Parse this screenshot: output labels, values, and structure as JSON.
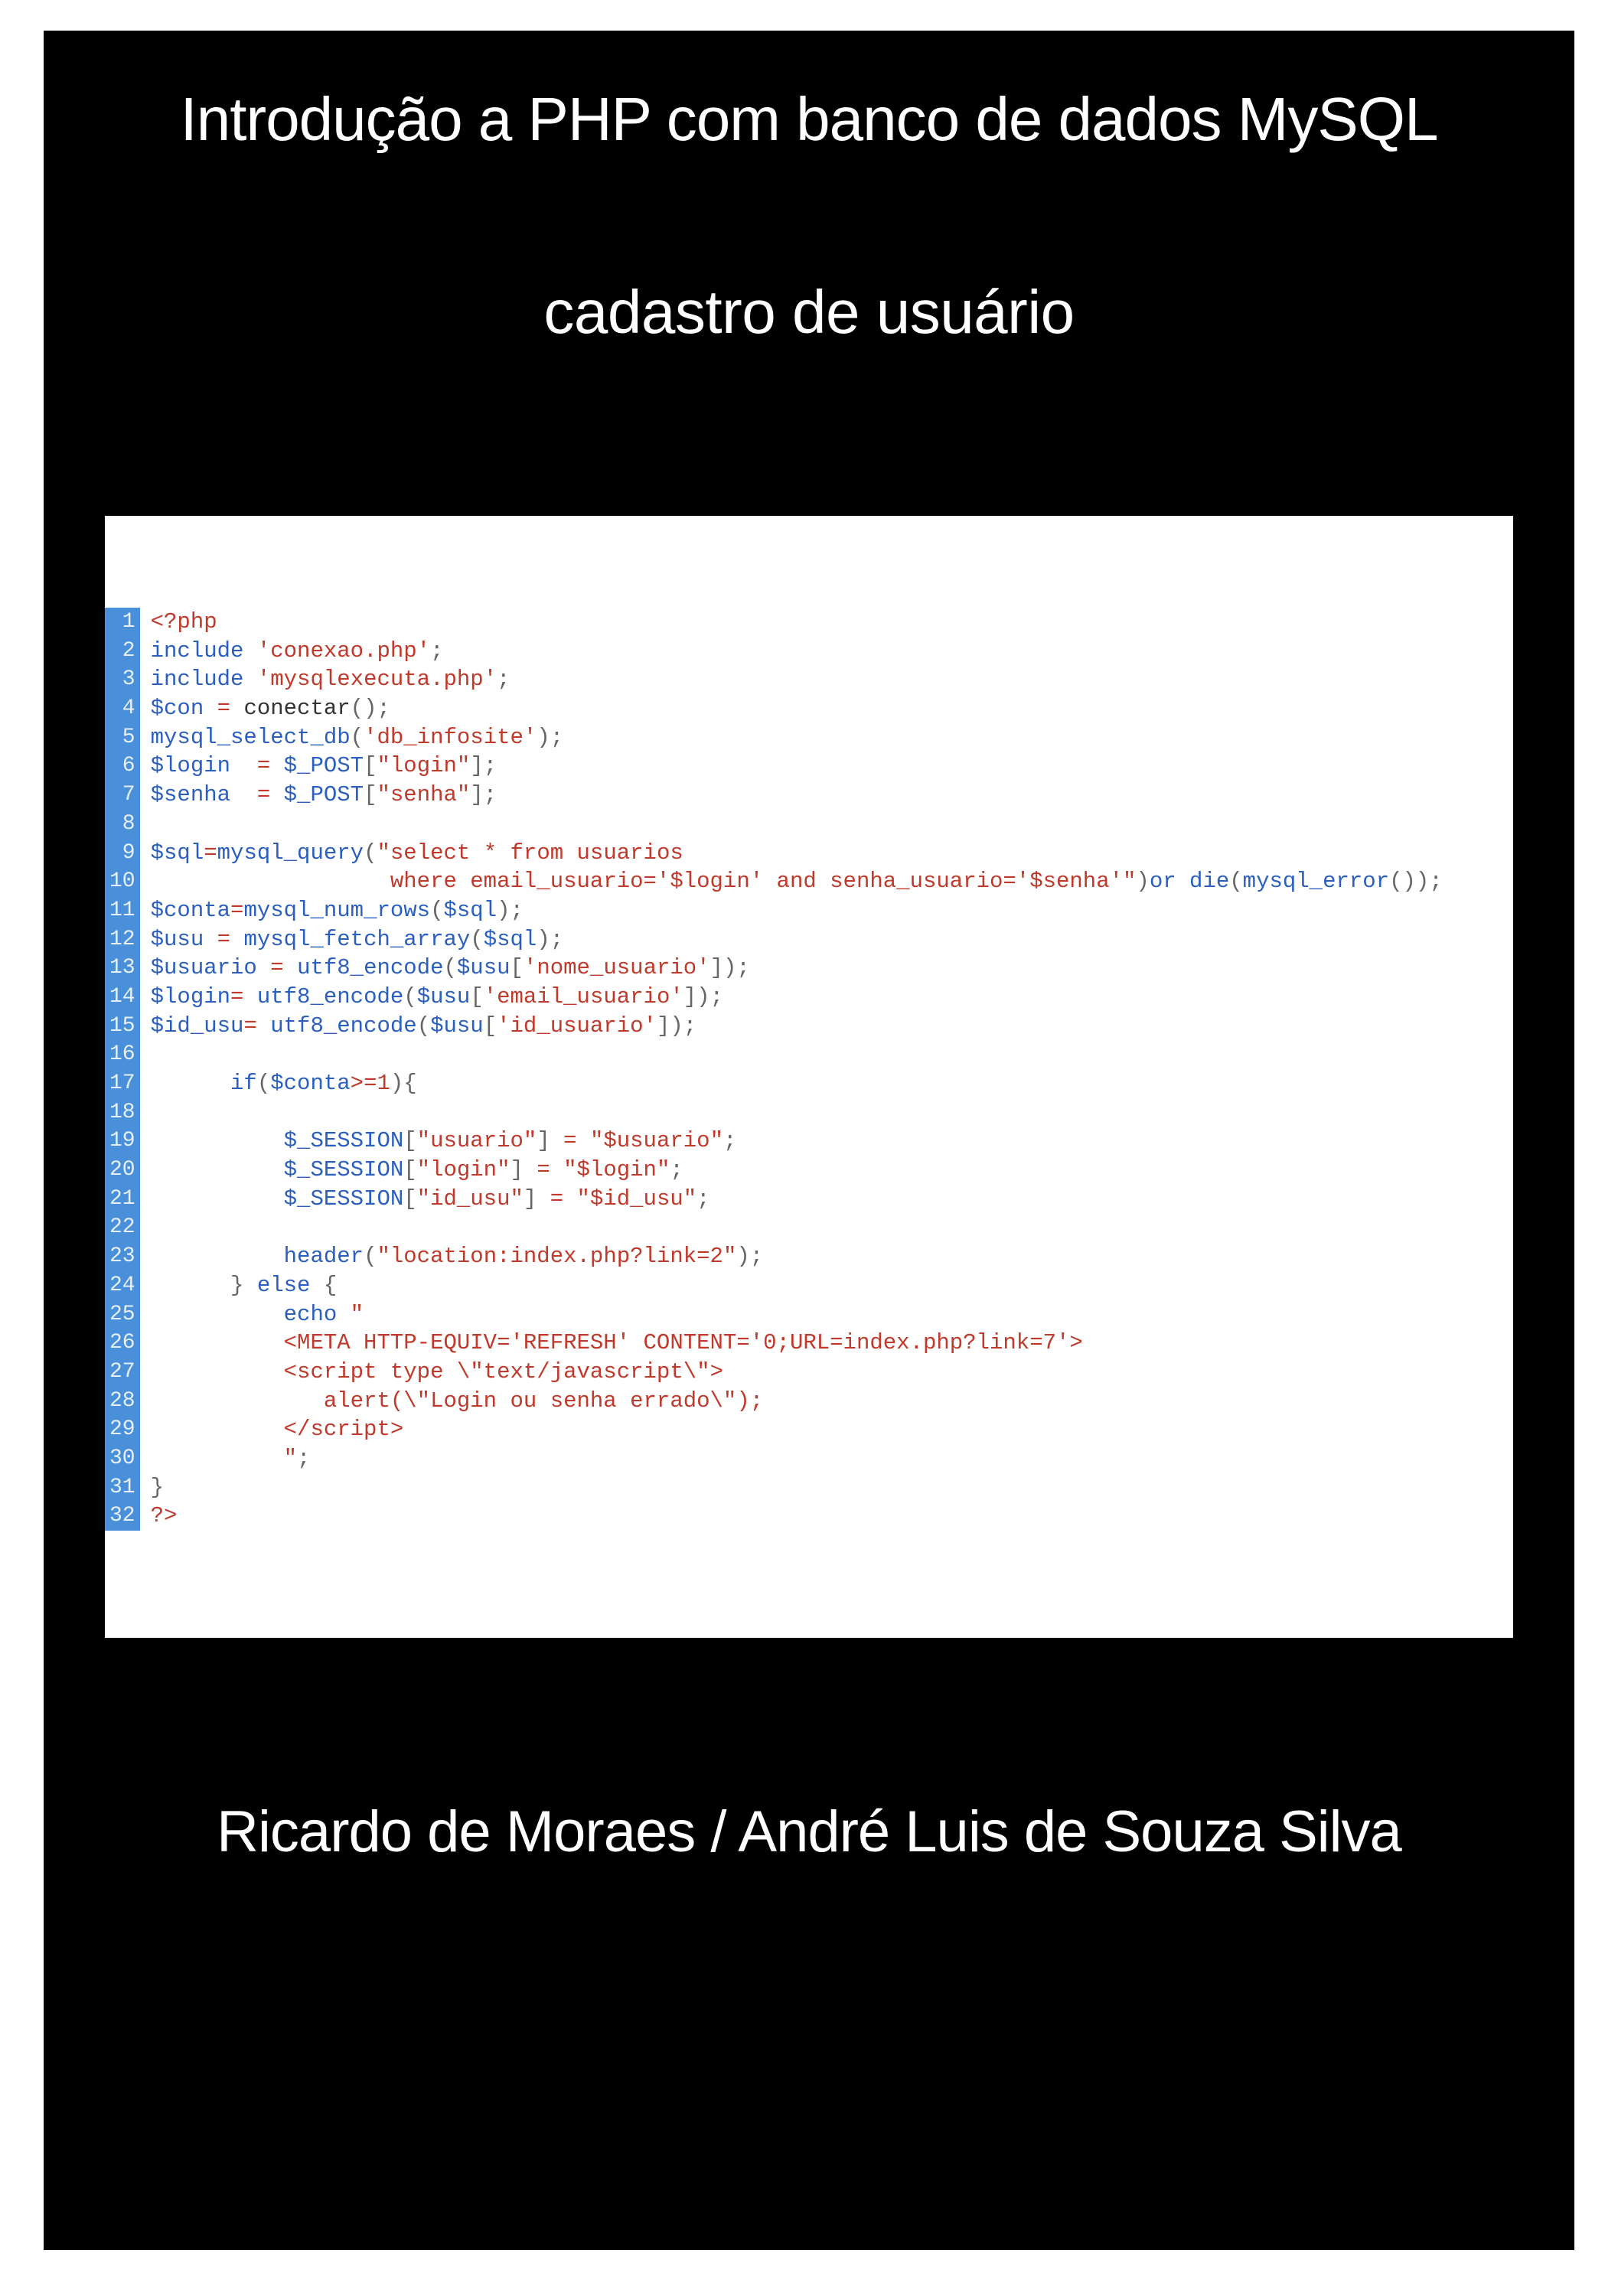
{
  "title": "Introdução a PHP com banco de dados MySQL",
  "subtitle": "cadastro de usuário",
  "authors": "Ricardo de Moraes / André Luis de Souza Silva",
  "code": {
    "lines": [
      {
        "n": 1,
        "segs": [
          {
            "t": "<?php",
            "c": "c-red"
          }
        ]
      },
      {
        "n": 2,
        "segs": [
          {
            "t": "include ",
            "c": "c-blue"
          },
          {
            "t": "'conexao.php'",
            "c": "c-red"
          },
          {
            "t": ";",
            "c": "c-gray"
          }
        ]
      },
      {
        "n": 3,
        "segs": [
          {
            "t": "include ",
            "c": "c-blue"
          },
          {
            "t": "'mysqlexecuta.php'",
            "c": "c-red"
          },
          {
            "t": ";",
            "c": "c-gray"
          }
        ]
      },
      {
        "n": 4,
        "segs": [
          {
            "t": "$con ",
            "c": "c-blue"
          },
          {
            "t": "= ",
            "c": "c-red"
          },
          {
            "t": "conectar",
            "c": "c-dark"
          },
          {
            "t": "();",
            "c": "c-gray"
          }
        ]
      },
      {
        "n": 5,
        "segs": [
          {
            "t": "mysql_select_db",
            "c": "c-blue"
          },
          {
            "t": "(",
            "c": "c-gray"
          },
          {
            "t": "'db_infosite'",
            "c": "c-red"
          },
          {
            "t": ");",
            "c": "c-gray"
          }
        ]
      },
      {
        "n": 6,
        "segs": [
          {
            "t": "$login  ",
            "c": "c-blue"
          },
          {
            "t": "= ",
            "c": "c-red"
          },
          {
            "t": "$_POST",
            "c": "c-blue"
          },
          {
            "t": "[",
            "c": "c-gray"
          },
          {
            "t": "\"login\"",
            "c": "c-red"
          },
          {
            "t": "];",
            "c": "c-gray"
          }
        ]
      },
      {
        "n": 7,
        "segs": [
          {
            "t": "$senha  ",
            "c": "c-blue"
          },
          {
            "t": "= ",
            "c": "c-red"
          },
          {
            "t": "$_POST",
            "c": "c-blue"
          },
          {
            "t": "[",
            "c": "c-gray"
          },
          {
            "t": "\"senha\"",
            "c": "c-red"
          },
          {
            "t": "];",
            "c": "c-gray"
          }
        ]
      },
      {
        "n": 8,
        "segs": [
          {
            "t": " ",
            "c": "c-gray"
          }
        ]
      },
      {
        "n": 9,
        "segs": [
          {
            "t": "$sql",
            "c": "c-blue"
          },
          {
            "t": "=",
            "c": "c-red"
          },
          {
            "t": "mysql_query",
            "c": "c-blue"
          },
          {
            "t": "(",
            "c": "c-gray"
          },
          {
            "t": "\"select * from usuarios",
            "c": "c-red"
          }
        ]
      },
      {
        "n": 10,
        "segs": [
          {
            "t": "                  where email_usuario='$login' and senha_usuario='$senha'\"",
            "c": "c-red"
          },
          {
            "t": ")",
            "c": "c-gray"
          },
          {
            "t": "or ",
            "c": "c-blue"
          },
          {
            "t": "die",
            "c": "c-blue"
          },
          {
            "t": "(",
            "c": "c-gray"
          },
          {
            "t": "mysql_error",
            "c": "c-blue"
          },
          {
            "t": "());",
            "c": "c-gray"
          }
        ]
      },
      {
        "n": 11,
        "segs": [
          {
            "t": "$conta",
            "c": "c-blue"
          },
          {
            "t": "=",
            "c": "c-red"
          },
          {
            "t": "mysql_num_rows",
            "c": "c-blue"
          },
          {
            "t": "(",
            "c": "c-gray"
          },
          {
            "t": "$sql",
            "c": "c-blue"
          },
          {
            "t": ");",
            "c": "c-gray"
          }
        ]
      },
      {
        "n": 12,
        "segs": [
          {
            "t": "$usu ",
            "c": "c-blue"
          },
          {
            "t": "= ",
            "c": "c-red"
          },
          {
            "t": "mysql_fetch_array",
            "c": "c-blue"
          },
          {
            "t": "(",
            "c": "c-gray"
          },
          {
            "t": "$sql",
            "c": "c-blue"
          },
          {
            "t": ");",
            "c": "c-gray"
          }
        ]
      },
      {
        "n": 13,
        "segs": [
          {
            "t": "$usuario ",
            "c": "c-blue"
          },
          {
            "t": "= ",
            "c": "c-red"
          },
          {
            "t": "utf8_encode",
            "c": "c-blue"
          },
          {
            "t": "(",
            "c": "c-gray"
          },
          {
            "t": "$usu",
            "c": "c-blue"
          },
          {
            "t": "[",
            "c": "c-gray"
          },
          {
            "t": "'nome_usuario'",
            "c": "c-red"
          },
          {
            "t": "]);",
            "c": "c-gray"
          }
        ]
      },
      {
        "n": 14,
        "segs": [
          {
            "t": "$login",
            "c": "c-blue"
          },
          {
            "t": "= ",
            "c": "c-red"
          },
          {
            "t": "utf8_encode",
            "c": "c-blue"
          },
          {
            "t": "(",
            "c": "c-gray"
          },
          {
            "t": "$usu",
            "c": "c-blue"
          },
          {
            "t": "[",
            "c": "c-gray"
          },
          {
            "t": "'email_usuario'",
            "c": "c-red"
          },
          {
            "t": "]);",
            "c": "c-gray"
          }
        ]
      },
      {
        "n": 15,
        "segs": [
          {
            "t": "$id_usu",
            "c": "c-blue"
          },
          {
            "t": "= ",
            "c": "c-red"
          },
          {
            "t": "utf8_encode",
            "c": "c-blue"
          },
          {
            "t": "(",
            "c": "c-gray"
          },
          {
            "t": "$usu",
            "c": "c-blue"
          },
          {
            "t": "[",
            "c": "c-gray"
          },
          {
            "t": "'id_usuario'",
            "c": "c-red"
          },
          {
            "t": "]);",
            "c": "c-gray"
          }
        ]
      },
      {
        "n": 16,
        "segs": [
          {
            "t": " ",
            "c": "c-gray"
          }
        ]
      },
      {
        "n": 17,
        "segs": [
          {
            "t": "      if",
            "c": "c-blue"
          },
          {
            "t": "(",
            "c": "c-gray"
          },
          {
            "t": "$conta",
            "c": "c-blue"
          },
          {
            "t": ">=",
            "c": "c-red"
          },
          {
            "t": "1",
            "c": "c-red"
          },
          {
            "t": "){",
            "c": "c-gray"
          }
        ]
      },
      {
        "n": 18,
        "segs": [
          {
            "t": " ",
            "c": "c-gray"
          }
        ]
      },
      {
        "n": 19,
        "segs": [
          {
            "t": "          $_SESSION",
            "c": "c-blue"
          },
          {
            "t": "[",
            "c": "c-gray"
          },
          {
            "t": "\"usuario\"",
            "c": "c-red"
          },
          {
            "t": "] ",
            "c": "c-gray"
          },
          {
            "t": "= ",
            "c": "c-red"
          },
          {
            "t": "\"$usuario\"",
            "c": "c-red"
          },
          {
            "t": ";",
            "c": "c-gray"
          }
        ]
      },
      {
        "n": 20,
        "segs": [
          {
            "t": "          $_SESSION",
            "c": "c-blue"
          },
          {
            "t": "[",
            "c": "c-gray"
          },
          {
            "t": "\"login\"",
            "c": "c-red"
          },
          {
            "t": "] ",
            "c": "c-gray"
          },
          {
            "t": "= ",
            "c": "c-red"
          },
          {
            "t": "\"$login\"",
            "c": "c-red"
          },
          {
            "t": ";",
            "c": "c-gray"
          }
        ]
      },
      {
        "n": 21,
        "segs": [
          {
            "t": "          $_SESSION",
            "c": "c-blue"
          },
          {
            "t": "[",
            "c": "c-gray"
          },
          {
            "t": "\"id_usu\"",
            "c": "c-red"
          },
          {
            "t": "] ",
            "c": "c-gray"
          },
          {
            "t": "= ",
            "c": "c-red"
          },
          {
            "t": "\"$id_usu\"",
            "c": "c-red"
          },
          {
            "t": ";",
            "c": "c-gray"
          }
        ]
      },
      {
        "n": 22,
        "segs": [
          {
            "t": " ",
            "c": "c-gray"
          }
        ]
      },
      {
        "n": 23,
        "segs": [
          {
            "t": "          header",
            "c": "c-blue"
          },
          {
            "t": "(",
            "c": "c-gray"
          },
          {
            "t": "\"location:index.php?link=2\"",
            "c": "c-red"
          },
          {
            "t": ");",
            "c": "c-gray"
          }
        ]
      },
      {
        "n": 24,
        "segs": [
          {
            "t": "      } ",
            "c": "c-gray"
          },
          {
            "t": "else ",
            "c": "c-blue"
          },
          {
            "t": "{",
            "c": "c-gray"
          }
        ]
      },
      {
        "n": 25,
        "segs": [
          {
            "t": "          echo ",
            "c": "c-blue"
          },
          {
            "t": "\"",
            "c": "c-red"
          }
        ]
      },
      {
        "n": 26,
        "segs": [
          {
            "t": "          <META HTTP-EQUIV='REFRESH' CONTENT='0;URL=index.php?link=7'>",
            "c": "c-red"
          }
        ]
      },
      {
        "n": 27,
        "segs": [
          {
            "t": "          <script type \\\"text/javascript\\\">",
            "c": "c-red"
          }
        ]
      },
      {
        "n": 28,
        "segs": [
          {
            "t": "             alert(\\\"Login ou senha errado\\\");",
            "c": "c-red"
          }
        ]
      },
      {
        "n": 29,
        "segs": [
          {
            "t": "          </scrip",
            "c": "c-red"
          },
          {
            "t": "t>",
            "c": "c-red"
          }
        ]
      },
      {
        "n": 30,
        "segs": [
          {
            "t": "          \"",
            "c": "c-red"
          },
          {
            "t": ";",
            "c": "c-gray"
          }
        ]
      },
      {
        "n": 31,
        "segs": [
          {
            "t": "}",
            "c": "c-gray"
          }
        ]
      },
      {
        "n": 32,
        "segs": [
          {
            "t": "?>",
            "c": "c-red"
          }
        ]
      }
    ]
  }
}
